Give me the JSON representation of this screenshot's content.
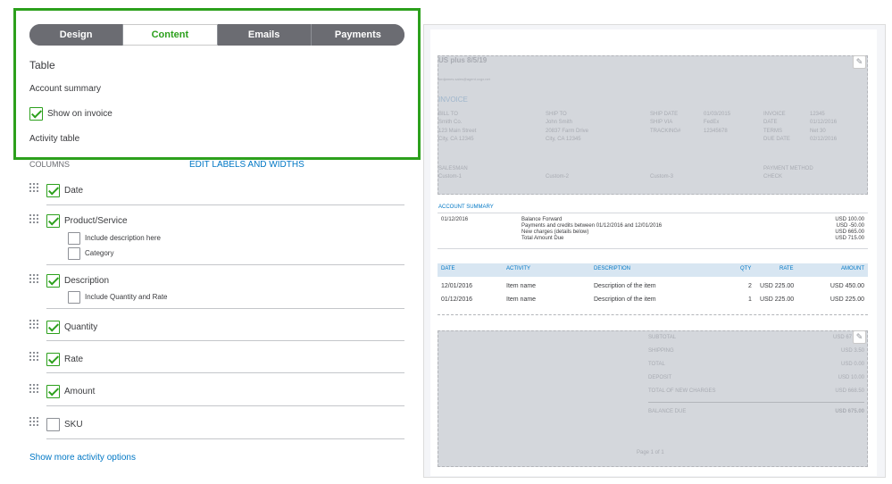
{
  "tabs": [
    {
      "label": "Design",
      "active": false
    },
    {
      "label": "Content",
      "active": true
    },
    {
      "label": "Emails",
      "active": false
    },
    {
      "label": "Payments",
      "active": false
    }
  ],
  "table_section": {
    "title": "Table",
    "account_summary_label": "Account summary",
    "show_on_invoice_label": "Show on invoice",
    "activity_table_label": "Activity table",
    "columns_label": "COLUMNS",
    "edit_labels_link": "EDIT LABELS AND WIDTHS"
  },
  "columns": [
    {
      "label": "Date",
      "checked": true
    },
    {
      "label": "Product/Service",
      "checked": true
    },
    {
      "label": "Include description here",
      "checked": false
    },
    {
      "label": "Category",
      "checked": false
    },
    {
      "label": "Description",
      "checked": true
    },
    {
      "label": "Include Quantity and Rate",
      "checked": false
    },
    {
      "label": "Quantity",
      "checked": true
    },
    {
      "label": "Rate",
      "checked": true
    },
    {
      "label": "Amount",
      "checked": true
    },
    {
      "label": "SKU",
      "checked": false
    }
  ],
  "show_more_link": "Show more activity options",
  "preview": {
    "company_name": "US plus 8/5/19",
    "email": "lordjames.sales@agent.ccgx.net",
    "invoice_title": "INVOICE",
    "bill_to_label": "BILL TO",
    "bill_to": [
      "Smith Co.",
      "123 Main Street",
      "City, CA 12345"
    ],
    "ship_to_label": "SHIP TO",
    "ship_to": [
      "John Smith",
      "20837 Farm Drive",
      "City, CA 12345"
    ],
    "ship_fields": [
      {
        "label": "SHIP DATE",
        "value": "01/03/2015"
      },
      {
        "label": "SHIP VIA",
        "value": "FedEx"
      },
      {
        "label": "TRACKING#",
        "value": "12345678"
      }
    ],
    "invoice_fields": [
      {
        "label": "INVOICE",
        "value": "12345"
      },
      {
        "label": "DATE",
        "value": "01/12/2016"
      },
      {
        "label": "TERMS",
        "value": "Net 30"
      },
      {
        "label": "DUE DATE",
        "value": "02/12/2016"
      }
    ],
    "salesman_label": "SALESMAN",
    "custom_fields": [
      "Custom-1",
      "Custom-2",
      "Custom-3"
    ],
    "payment_method_label": "PAYMENT METHOD",
    "payment_method": "CHECK",
    "account_summary_title": "ACCOUNT SUMMARY",
    "summary_date": "01/12/2016",
    "summary_lines": [
      "Balance Forward",
      "Payments and credits between 01/12/2016 and 12/01/2016",
      "New charges (details below)",
      "Total Amount Due"
    ],
    "summary_amounts": [
      "USD 100.00",
      "USD -50.00",
      "USD 665.00",
      "USD 715.00"
    ],
    "activity_headers": [
      "DATE",
      "ACTIVITY",
      "DESCRIPTION",
      "QTY",
      "RATE",
      "AMOUNT"
    ],
    "activity_rows": [
      [
        "12/01/2016",
        "Item name",
        "Description of the item",
        "2",
        "USD 225.00",
        "USD 450.00"
      ],
      [
        "01/12/2016",
        "Item name",
        "Description of the item",
        "1",
        "USD 225.00",
        "USD 225.00"
      ]
    ],
    "totals": [
      {
        "label": "SUBTOTAL",
        "value": "USD 67"
      },
      {
        "label": "SHIPPING",
        "value": "USD 3.50"
      },
      {
        "label": "TOTAL",
        "value": "USD 0.00"
      },
      {
        "label": "DEPOSIT",
        "value": "USD 10.00"
      },
      {
        "label": "TOTAL OF NEW CHARGES",
        "value": "USD 668.50"
      }
    ],
    "balance_due_label": "BALANCE DUE",
    "balance_due_value": "USD 675.00",
    "page_label": "Page 1 of 1"
  }
}
